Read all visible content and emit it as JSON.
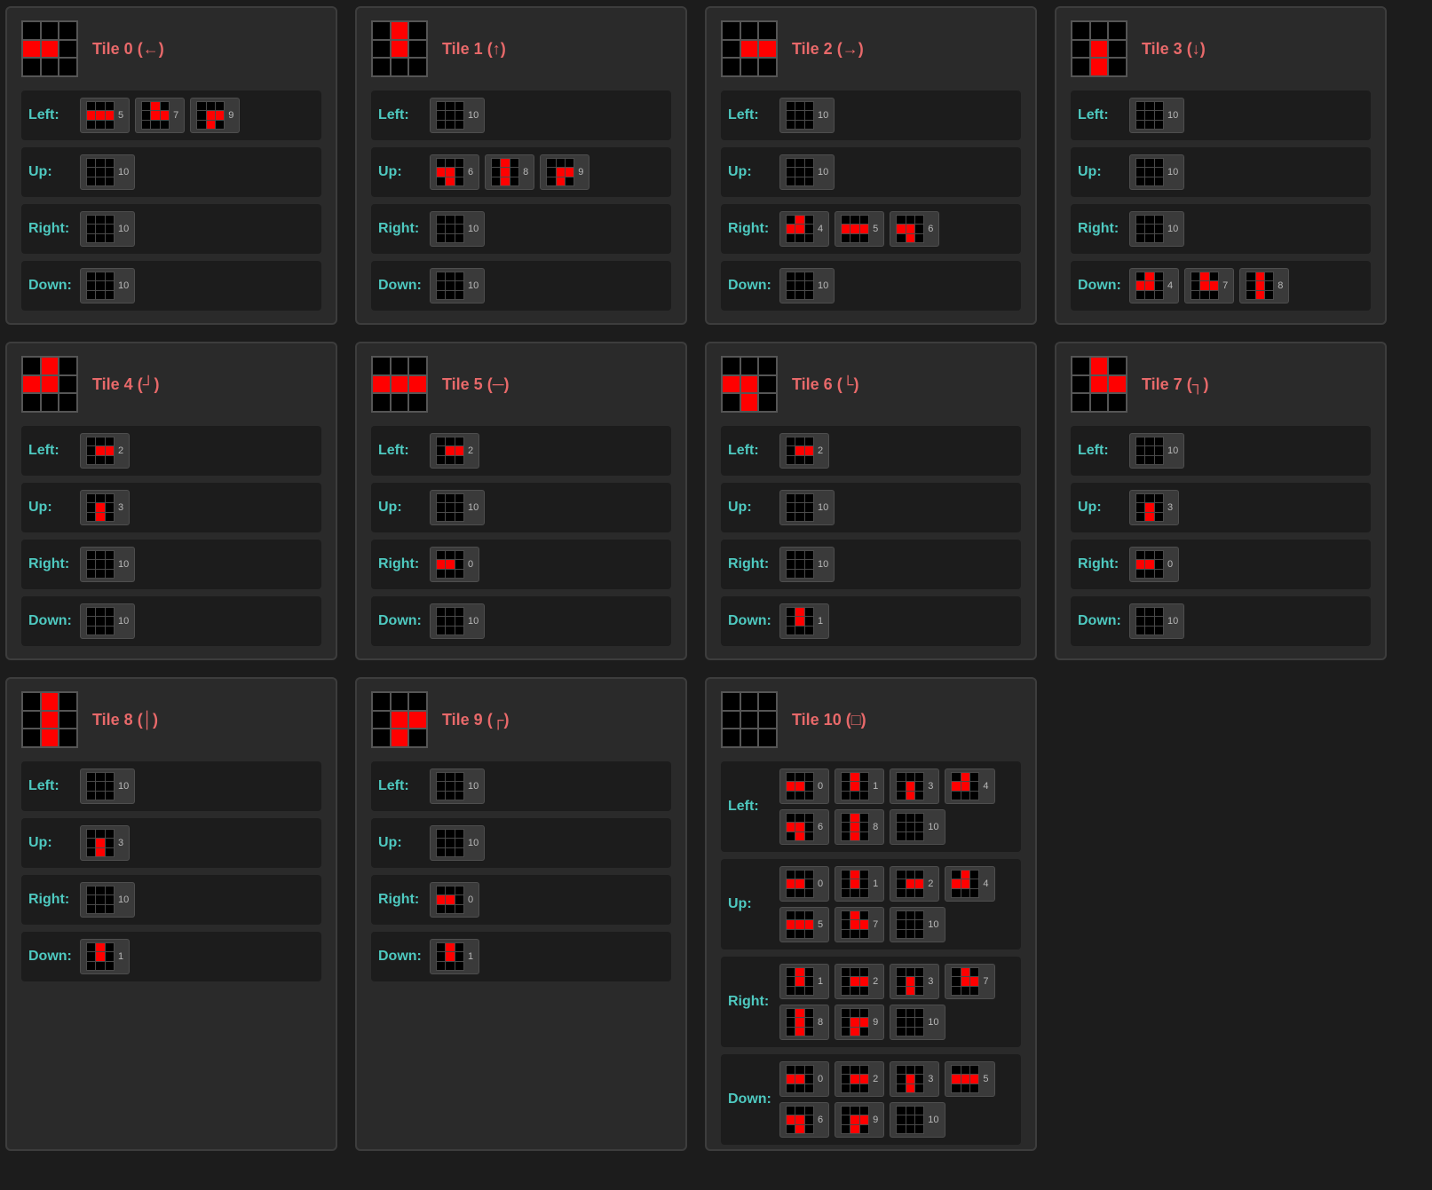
{
  "tiles": [
    {
      "id": 0,
      "title": "Tile 0 (←)",
      "pattern": [
        0,
        0,
        0,
        1,
        1,
        0,
        0,
        0,
        0
      ],
      "neighbors": {
        "left": [
          5,
          7,
          9
        ],
        "up": [
          10
        ],
        "right": [
          10
        ],
        "down": [
          10
        ]
      }
    },
    {
      "id": 1,
      "title": "Tile 1 (↑)",
      "pattern": [
        0,
        1,
        0,
        0,
        1,
        0,
        0,
        0,
        0
      ],
      "neighbors": {
        "left": [
          10
        ],
        "up": [
          6,
          8,
          9
        ],
        "right": [
          10
        ],
        "down": [
          10
        ]
      }
    },
    {
      "id": 2,
      "title": "Tile 2 (→)",
      "pattern": [
        0,
        0,
        0,
        0,
        1,
        1,
        0,
        0,
        0
      ],
      "neighbors": {
        "left": [
          10
        ],
        "up": [
          10
        ],
        "right": [
          4,
          5,
          6
        ],
        "down": [
          10
        ]
      }
    },
    {
      "id": 3,
      "title": "Tile 3 (↓)",
      "pattern": [
        0,
        0,
        0,
        0,
        1,
        0,
        0,
        1,
        0
      ],
      "neighbors": {
        "left": [
          10
        ],
        "up": [
          10
        ],
        "right": [
          10
        ],
        "down": [
          4,
          7,
          8
        ]
      }
    },
    {
      "id": 4,
      "title": "Tile 4 (┘)",
      "pattern": [
        0,
        1,
        0,
        1,
        1,
        0,
        0,
        0,
        0
      ],
      "neighbors": {
        "left": [
          2
        ],
        "up": [
          3
        ],
        "right": [
          10
        ],
        "down": [
          10
        ]
      }
    },
    {
      "id": 5,
      "title": "Tile 5 (─)",
      "pattern": [
        0,
        0,
        0,
        1,
        1,
        1,
        0,
        0,
        0
      ],
      "neighbors": {
        "left": [
          2
        ],
        "up": [
          10
        ],
        "right": [
          0
        ],
        "down": [
          10
        ]
      }
    },
    {
      "id": 6,
      "title": "Tile 6 (└)",
      "pattern": [
        0,
        0,
        0,
        1,
        1,
        0,
        0,
        1,
        0
      ],
      "neighbors": {
        "left": [
          2
        ],
        "up": [
          10
        ],
        "right": [
          10
        ],
        "down": [
          1
        ]
      }
    },
    {
      "id": 7,
      "title": "Tile 7 (┐)",
      "pattern": [
        0,
        1,
        0,
        0,
        1,
        1,
        0,
        0,
        0
      ],
      "neighbors": {
        "left": [
          10
        ],
        "up": [
          3
        ],
        "right": [
          0
        ],
        "down": [
          10
        ]
      }
    },
    {
      "id": 8,
      "title": "Tile 8 (│)",
      "pattern": [
        0,
        1,
        0,
        0,
        1,
        0,
        0,
        1,
        0
      ],
      "neighbors": {
        "left": [
          10
        ],
        "up": [
          3
        ],
        "right": [
          10
        ],
        "down": [
          1
        ]
      }
    },
    {
      "id": 9,
      "title": "Tile 9 (┌)",
      "pattern": [
        0,
        0,
        0,
        0,
        1,
        1,
        0,
        1,
        0
      ],
      "neighbors": {
        "left": [
          10
        ],
        "up": [
          10
        ],
        "right": [
          0
        ],
        "down": [
          1
        ]
      }
    },
    {
      "id": 10,
      "title": "Tile 10 (□)",
      "pattern": [
        0,
        0,
        0,
        0,
        0,
        0,
        0,
        0,
        0
      ],
      "neighbors": {
        "left": [
          0,
          1,
          3,
          4,
          6,
          8,
          10
        ],
        "up": [
          0,
          1,
          2,
          4,
          5,
          7,
          10
        ],
        "right": [
          1,
          2,
          3,
          7,
          8,
          9,
          10
        ],
        "down": [
          0,
          2,
          3,
          5,
          6,
          9,
          10
        ]
      }
    }
  ],
  "direction_labels": {
    "left": "Left:",
    "up": "Up:",
    "right": "Right:",
    "down": "Down:"
  },
  "direction_order": [
    "left",
    "up",
    "right",
    "down"
  ],
  "colors": {
    "active_cell": "#ff0000",
    "title": "#e8696a",
    "direction_label": "#4ec9c0"
  }
}
